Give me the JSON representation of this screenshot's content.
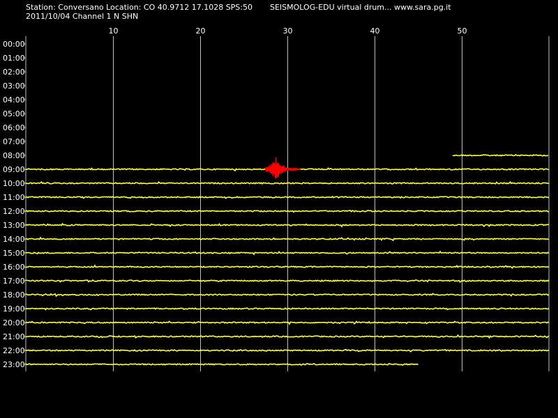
{
  "header": {
    "station_line": "Station: Conversano Location: CO 40.9712 17.1028 SPS:50",
    "date_line": "2011/10/04  Channel 1 N SHN",
    "app_title": "SEISMOLOG-EDU virtual drum... www.sara.pg.it"
  },
  "chart_data": {
    "type": "line",
    "title": "",
    "xlabel": "",
    "ylabel": "",
    "x_ticks": [
      10,
      20,
      30,
      40,
      50
    ],
    "xlim": [
      0,
      60
    ],
    "vertical_grid": true,
    "rows": [
      "00:00",
      "01:00",
      "02:00",
      "03:00",
      "04:00",
      "05:00",
      "06:00",
      "07:00",
      "08:00",
      "09:00",
      "10:00",
      "11:00",
      "12:00",
      "13:00",
      "14:00",
      "15:00",
      "16:00",
      "17:00",
      "18:00",
      "19:00",
      "20:00",
      "21:00",
      "22:00",
      "23:00"
    ],
    "traces": [
      {
        "row": "08:00",
        "start_min": 49,
        "end_min": 60
      },
      {
        "row": "09:00",
        "start_min": 0,
        "end_min": 60
      },
      {
        "row": "10:00",
        "start_min": 0,
        "end_min": 60
      },
      {
        "row": "11:00",
        "start_min": 0,
        "end_min": 60
      },
      {
        "row": "12:00",
        "start_min": 0,
        "end_min": 60
      },
      {
        "row": "13:00",
        "start_min": 0,
        "end_min": 60
      },
      {
        "row": "14:00",
        "start_min": 0,
        "end_min": 60
      },
      {
        "row": "15:00",
        "start_min": 0,
        "end_min": 60
      },
      {
        "row": "16:00",
        "start_min": 0,
        "end_min": 60
      },
      {
        "row": "17:00",
        "start_min": 0,
        "end_min": 60
      },
      {
        "row": "18:00",
        "start_min": 0,
        "end_min": 60
      },
      {
        "row": "19:00",
        "start_min": 0,
        "end_min": 60
      },
      {
        "row": "20:00",
        "start_min": 0,
        "end_min": 60
      },
      {
        "row": "21:00",
        "start_min": 0,
        "end_min": 60
      },
      {
        "row": "22:00",
        "start_min": 0,
        "end_min": 60
      },
      {
        "row": "23:00",
        "start_min": 0,
        "end_min": 45
      }
    ],
    "event": {
      "row": "09:00",
      "start_min": 27.5,
      "peak_min": 28.7,
      "end_min": 31.5
    },
    "colors": {
      "background": "#000000",
      "trace": "#ffff33",
      "event": "#ff0000",
      "grid": "#c0c0c0",
      "text": "#ffffff"
    }
  }
}
